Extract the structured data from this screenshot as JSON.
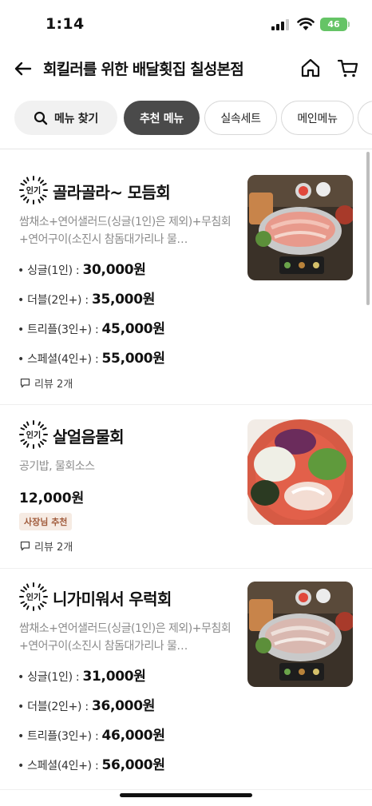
{
  "status_bar": {
    "time": "1:14",
    "battery": "46"
  },
  "header": {
    "title": "회킬러를 위한 배달횟집 칠성본점",
    "icons": [
      "back-arrow-icon",
      "home-icon",
      "cart-icon"
    ]
  },
  "chips": [
    {
      "label": "메뉴 찾기",
      "icon": "search-icon"
    },
    {
      "label": "추천 메뉴",
      "active": true
    },
    {
      "label": "실속세트"
    },
    {
      "label": "메인메뉴"
    },
    {
      "label": ""
    }
  ],
  "badge_label": "인기",
  "items": [
    {
      "name": "골라골라~ 모듬회",
      "desc": "쌈채소+연어샐러드(싱글(1인)은 제외)+무침회+연어구이(소진시 참돔대가리나 물…",
      "prices": [
        {
          "label": "싱글(1인)",
          "value": "30,000원"
        },
        {
          "label": "더블(2인+)",
          "value": "35,000원"
        },
        {
          "label": "트리플(3인+)",
          "value": "45,000원"
        },
        {
          "label": "스페셜(4인+)",
          "value": "55,000원"
        }
      ],
      "review": "리뷰 2개"
    },
    {
      "name": "살얼음물회",
      "desc": "공기밥, 물회소스",
      "price": "12,000원",
      "owner_badge": "사장님 추천",
      "review": "리뷰 2개"
    },
    {
      "name": "니가미워서 우럭회",
      "desc": "쌈채소+연어샐러드(싱글(1인)은 제외)+무침회+연어구이(소진시 참돔대가리나 물…",
      "prices": [
        {
          "label": "싱글(1인)",
          "value": "31,000원"
        },
        {
          "label": "더블(2인+)",
          "value": "36,000원"
        },
        {
          "label": "트리플(3인+)",
          "value": "46,000원"
        },
        {
          "label": "스페셜(4인+)",
          "value": "56,000원"
        }
      ]
    }
  ],
  "colors": {
    "active_chip": "#4a4a4a",
    "owner_badge_bg": "#f6ebe3",
    "owner_badge_text": "#a05a3a",
    "battery": "#65c466"
  }
}
